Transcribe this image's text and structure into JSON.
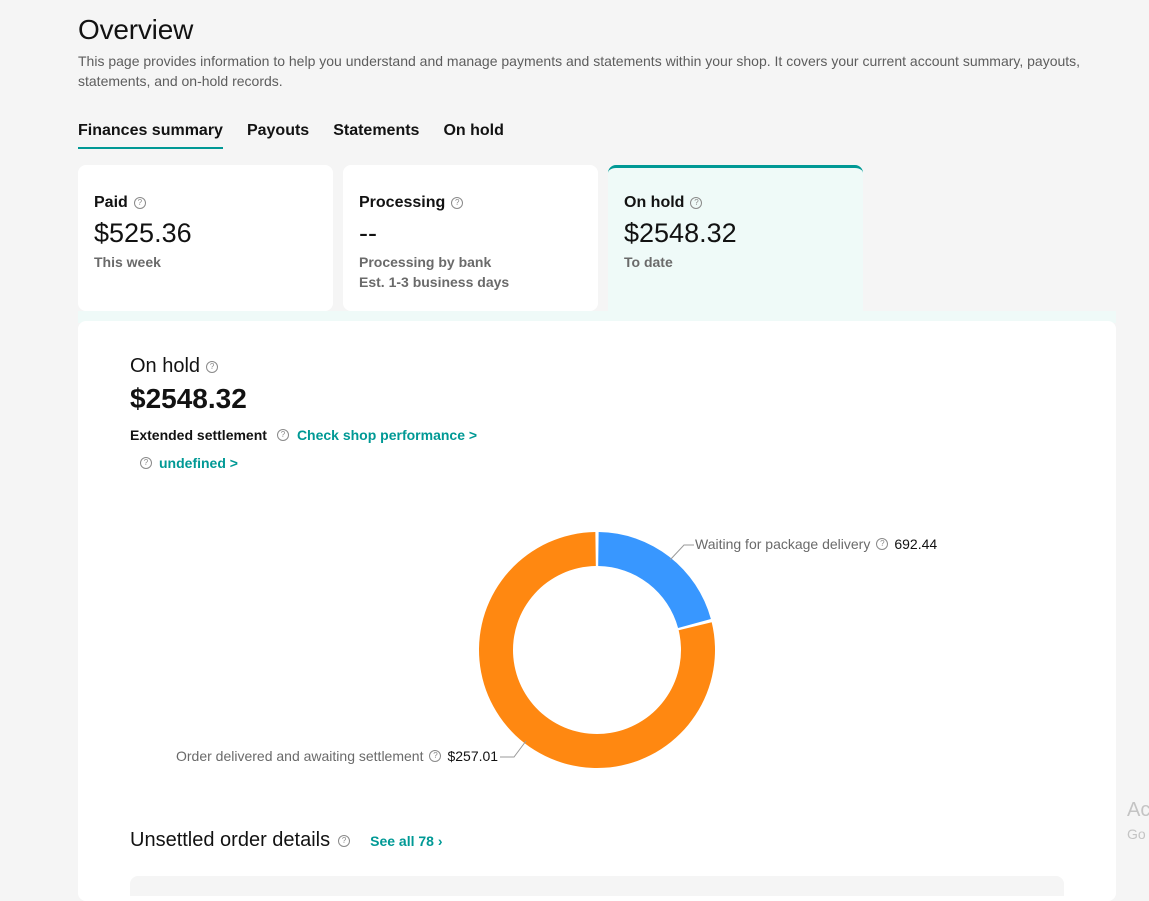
{
  "header": {
    "title": "Overview",
    "subtitle": "This page provides information to help you understand and manage payments and statements within your shop. It covers your current account summary, payouts, statements, and on-hold records."
  },
  "tabs": [
    {
      "label": "Finances summary",
      "active": true
    },
    {
      "label": "Payouts"
    },
    {
      "label": "Statements"
    },
    {
      "label": "On hold"
    }
  ],
  "cards": [
    {
      "label": "Paid",
      "value": "$525.36",
      "sub": "This week",
      "sub2": ""
    },
    {
      "label": "Processing",
      "value": "--",
      "sub": "Processing by bank",
      "sub2": "Est. 1-3 business days"
    },
    {
      "label": "On hold",
      "value": "$2548.32",
      "sub": "To date",
      "sub2": "",
      "selected": true
    }
  ],
  "on_hold": {
    "label": "On hold",
    "value": "$2548.32",
    "extended_label": "Extended settlement",
    "check_link": "Check shop performance >",
    "undefined_link": "undefined >"
  },
  "chart_data": {
    "type": "pie",
    "variant": "donut",
    "slices": [
      {
        "label": "Waiting for package delivery",
        "value_text": "692.44",
        "value": 692.44,
        "color": "#3897ff"
      },
      {
        "label": "Order delivered and awaiting settlement",
        "value_text": "$257.01",
        "value": 257.01,
        "color": "#ff8811"
      }
    ],
    "visual_fractions": [
      0.21,
      0.79
    ]
  },
  "unsettled": {
    "title": "Unsettled order details",
    "see_all": "See all 78"
  },
  "colors": {
    "accent": "#009995",
    "blue": "#3897ff",
    "orange": "#ff8811"
  },
  "watermark": {
    "line1": "Ac",
    "line2": "Go"
  }
}
